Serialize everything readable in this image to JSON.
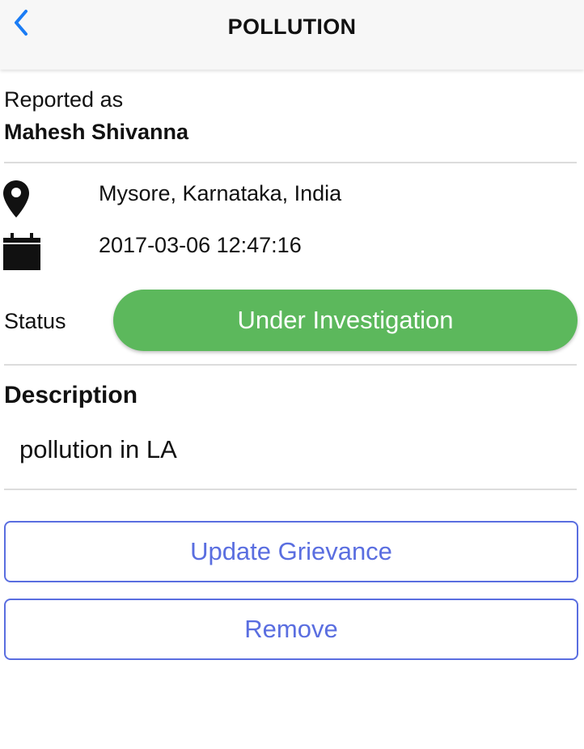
{
  "header": {
    "title": "POLLUTION",
    "back_icon": "chevron-left-icon",
    "accent_color": "#1a7cf5"
  },
  "reporter": {
    "label": "Reported as",
    "name": "Mahesh Shivanna"
  },
  "location": {
    "icon": "map-pin-icon",
    "text": "Mysore, Karnataka, India"
  },
  "datetime": {
    "icon": "calendar-icon",
    "text": "2017-03-06 12:47:16"
  },
  "status": {
    "label": "Status",
    "value": "Under Investigation",
    "color": "#5cb85c"
  },
  "description": {
    "heading": "Description",
    "body": "pollution in LA"
  },
  "actions": {
    "update_label": "Update Grievance",
    "remove_label": "Remove",
    "button_color": "#5a6ee0"
  }
}
